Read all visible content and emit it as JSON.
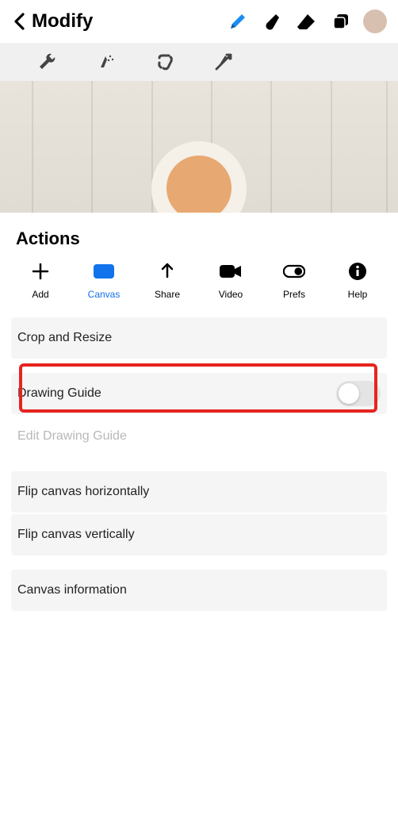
{
  "topbar": {
    "title": "Modify"
  },
  "panel": {
    "title": "Actions",
    "tabs": [
      {
        "label": "Add"
      },
      {
        "label": "Canvas"
      },
      {
        "label": "Share"
      },
      {
        "label": "Video"
      },
      {
        "label": "Prefs"
      },
      {
        "label": "Help"
      }
    ],
    "rows": {
      "crop": "Crop and Resize",
      "drawing_guide": "Drawing Guide",
      "edit_drawing_guide": "Edit Drawing Guide",
      "flip_h": "Flip canvas horizontally",
      "flip_v": "Flip canvas vertically",
      "canvas_info": "Canvas information"
    }
  }
}
